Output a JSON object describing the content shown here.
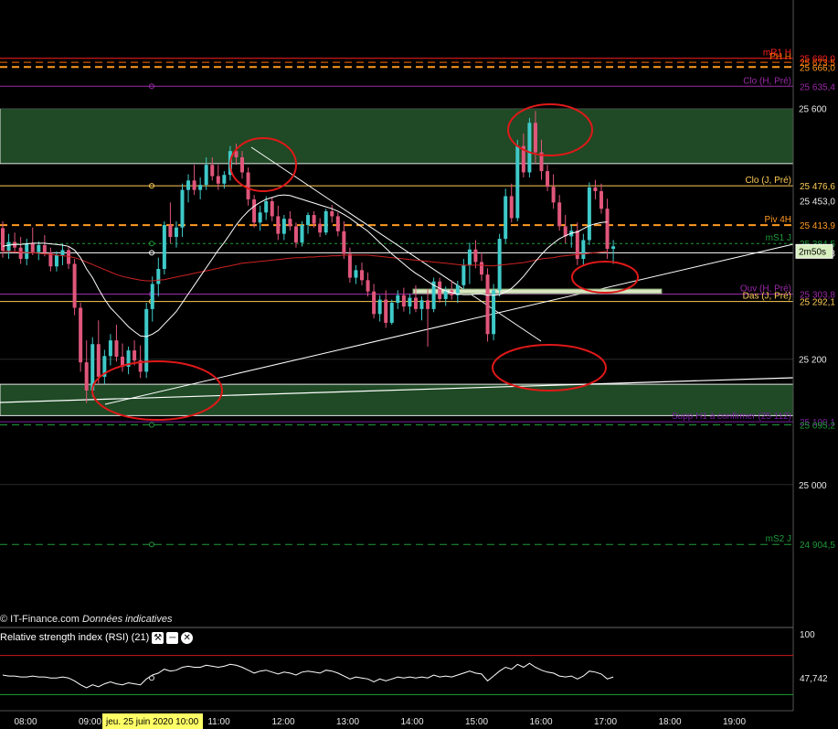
{
  "chart_data": [
    {
      "type": "candlestick",
      "timeframe": "2m",
      "ylim": [
        24810,
        25700
      ],
      "y_ticks": [
        "25 600",
        "25 200",
        "25 000"
      ],
      "y_tick_values": [
        25600,
        25200,
        25000
      ],
      "x_ticks": [
        "08:00",
        "09:00",
        "11:00",
        "12:00",
        "13:00",
        "14:00",
        "15:00",
        "16:00",
        "17:00",
        "18:00",
        "19:00"
      ],
      "x_tick_hours": [
        8,
        9,
        11,
        12,
        13,
        14,
        15,
        16,
        17,
        18,
        19
      ],
      "cursor_date_label": "jeu. 25 juin 2020 10:00",
      "candles": [
        [
          25409,
          25420,
          25362,
          25373
        ],
        [
          25373,
          25400,
          25360,
          25387
        ],
        [
          25387,
          25402,
          25370,
          25378
        ],
        [
          25378,
          25395,
          25352,
          25360
        ],
        [
          25360,
          25392,
          25350,
          25385
        ],
        [
          25385,
          25410,
          25366,
          25371
        ],
        [
          25371,
          25388,
          25358,
          25382
        ],
        [
          25382,
          25398,
          25364,
          25370
        ],
        [
          25370,
          25378,
          25340,
          25348
        ],
        [
          25348,
          25372,
          25340,
          25366
        ],
        [
          25366,
          25384,
          25350,
          25374
        ],
        [
          25374,
          25380,
          25344,
          25352
        ],
        [
          25352,
          25360,
          25270,
          25282
        ],
        [
          25282,
          25290,
          25180,
          25195
        ],
        [
          25195,
          25230,
          25130,
          25150
        ],
        [
          25150,
          25235,
          25140,
          25224
        ],
        [
          25224,
          25262,
          25160,
          25172
        ],
        [
          25172,
          25215,
          25160,
          25205
        ],
        [
          25205,
          25240,
          25190,
          25230
        ],
        [
          25230,
          25255,
          25196,
          25204
        ],
        [
          25204,
          25225,
          25180,
          25188
        ],
        [
          25188,
          25220,
          25176,
          25214
        ],
        [
          25214,
          25230,
          25190,
          25198
        ],
        [
          25198,
          25222,
          25170,
          25180
        ],
        [
          25180,
          25290,
          25170,
          25280
        ],
        [
          25280,
          25332,
          25260,
          25320
        ],
        [
          25320,
          25362,
          25300,
          25344
        ],
        [
          25344,
          25420,
          25335,
          25414
        ],
        [
          25414,
          25450,
          25385,
          25395
        ],
        [
          25395,
          25420,
          25378,
          25410
        ],
        [
          25410,
          25480,
          25395,
          25470
        ],
        [
          25470,
          25495,
          25450,
          25485
        ],
        [
          25485,
          25510,
          25462,
          25470
        ],
        [
          25470,
          25490,
          25455,
          25478
        ],
        [
          25478,
          25522,
          25470,
          25510
        ],
        [
          25510,
          25522,
          25485,
          25492
        ],
        [
          25492,
          25510,
          25470,
          25480
        ],
        [
          25480,
          25500,
          25472,
          25494
        ],
        [
          25494,
          25540,
          25485,
          25532
        ],
        [
          25532,
          25544,
          25510,
          25522
        ],
        [
          25522,
          25532,
          25488,
          25498
        ],
        [
          25498,
          25506,
          25445,
          25455
        ],
        [
          25455,
          25462,
          25410,
          25418
        ],
        [
          25418,
          25445,
          25405,
          25434
        ],
        [
          25434,
          25460,
          25422,
          25452
        ],
        [
          25452,
          25458,
          25420,
          25428
        ],
        [
          25428,
          25445,
          25390,
          25400
        ],
        [
          25400,
          25430,
          25390,
          25424
        ],
        [
          25424,
          25436,
          25405,
          25412
        ],
        [
          25412,
          25418,
          25378,
          25386
        ],
        [
          25386,
          25420,
          25380,
          25414
        ],
        [
          25414,
          25434,
          25400,
          25430
        ],
        [
          25430,
          25436,
          25410,
          25416
        ],
        [
          25416,
          25425,
          25395,
          25402
        ],
        [
          25402,
          25440,
          25398,
          25436
        ],
        [
          25436,
          25446,
          25418,
          25428
        ],
        [
          25428,
          25434,
          25396,
          25404
        ],
        [
          25404,
          25420,
          25360,
          25368
        ],
        [
          25368,
          25378,
          25322,
          25330
        ],
        [
          25330,
          25350,
          25320,
          25342
        ],
        [
          25342,
          25354,
          25318,
          25326
        ],
        [
          25326,
          25338,
          25300,
          25308
        ],
        [
          25308,
          25320,
          25265,
          25272
        ],
        [
          25272,
          25302,
          25260,
          25295
        ],
        [
          25295,
          25310,
          25250,
          25258
        ],
        [
          25258,
          25295,
          25255,
          25290
        ],
        [
          25290,
          25310,
          25280,
          25302
        ],
        [
          25302,
          25314,
          25276,
          25284
        ],
        [
          25284,
          25304,
          25272,
          25298
        ],
        [
          25298,
          25318,
          25275,
          25280
        ],
        [
          25280,
          25300,
          25262,
          25294
        ],
        [
          25294,
          25312,
          25220,
          25280
        ],
        [
          25280,
          25330,
          25275,
          25324
        ],
        [
          25324,
          25330,
          25290,
          25296
        ],
        [
          25296,
          25316,
          25285,
          25310
        ],
        [
          25310,
          25326,
          25295,
          25302
        ],
        [
          25302,
          25325,
          25290,
          25318
        ],
        [
          25318,
          25360,
          25312,
          25350
        ],
        [
          25350,
          25386,
          25320,
          25375
        ],
        [
          25375,
          25390,
          25345,
          25355
        ],
        [
          25355,
          25370,
          25325,
          25335
        ],
        [
          25335,
          25345,
          25228,
          25240
        ],
        [
          25240,
          25320,
          25230,
          25310
        ],
        [
          25310,
          25400,
          25300,
          25392
        ],
        [
          25392,
          25472,
          25385,
          25460
        ],
        [
          25460,
          25480,
          25418,
          25425
        ],
        [
          25425,
          25550,
          25420,
          25540
        ],
        [
          25540,
          25560,
          25490,
          25498
        ],
        [
          25498,
          25585,
          25490,
          25577
        ],
        [
          25577,
          25596,
          25512,
          25530
        ],
        [
          25530,
          25550,
          25486,
          25500
        ],
        [
          25500,
          25510,
          25468,
          25475
        ],
        [
          25475,
          25495,
          25440,
          25450
        ],
        [
          25450,
          25462,
          25405,
          25412
        ],
        [
          25412,
          25430,
          25385,
          25396
        ],
        [
          25396,
          25415,
          25378,
          25405
        ],
        [
          25405,
          25418,
          25350,
          25360
        ],
        [
          25360,
          25400,
          25350,
          25390
        ],
        [
          25390,
          25482,
          25382,
          25474
        ],
        [
          25474,
          25486,
          25455,
          25468
        ],
        [
          25468,
          25480,
          25432,
          25440
        ],
        [
          25440,
          25456,
          25360,
          25376
        ],
        [
          25376,
          25390,
          25352,
          25380
        ]
      ],
      "sma20": [
        25380,
        25382,
        25383,
        25383,
        25384,
        25385,
        25385,
        25385,
        25384,
        25383,
        25382,
        25380,
        25374,
        25362,
        25344,
        25330,
        25312,
        25296,
        25282,
        25272,
        25262,
        25252,
        25244,
        25237,
        25236,
        25240,
        25246,
        25256,
        25266,
        25276,
        25290,
        25304,
        25318,
        25332,
        25346,
        25360,
        25374,
        25386,
        25400,
        25414,
        25426,
        25436,
        25444,
        25450,
        25455,
        25458,
        25461,
        25462,
        25461,
        25458,
        25455,
        25452,
        25449,
        25446,
        25443,
        25440,
        25436,
        25431,
        25425,
        25418,
        25411,
        25404,
        25395,
        25386,
        25377,
        25368,
        25360,
        25352,
        25344,
        25337,
        25331,
        25324,
        25318,
        25313,
        25309,
        25306,
        25304,
        25303,
        25303,
        25304,
        25304,
        25302,
        25302,
        25303,
        25307,
        25313,
        25322,
        25332,
        25344,
        25356,
        25367,
        25377,
        25385,
        25392,
        25397,
        25401,
        25403,
        25408,
        25413,
        25416,
        25418,
        25419
      ],
      "sma100": [
        25372,
        25372,
        25371,
        25371,
        25370,
        25370,
        25369,
        25368,
        25367,
        25366,
        25365,
        25364,
        25362,
        25359,
        25355,
        25351,
        25347,
        25343,
        25339,
        25335,
        25332,
        25330,
        25328,
        25326,
        25325,
        25325,
        25326,
        25327,
        25329,
        25331,
        25333,
        25335,
        25337,
        25339,
        25341,
        25343,
        25345,
        25347,
        25349,
        25351,
        25353,
        25354,
        25355,
        25356,
        25357,
        25358,
        25359,
        25360,
        25361,
        25362,
        25362,
        25363,
        25363,
        25364,
        25364,
        25365,
        25365,
        25366,
        25366,
        25366,
        25366,
        25366,
        25365,
        25364,
        25363,
        25362,
        25361,
        25360,
        25359,
        25358,
        25357,
        25356,
        25355,
        25354,
        25353,
        25352,
        25351,
        25350,
        25350,
        25350,
        25350,
        25349,
        25349,
        25350,
        25351,
        25352,
        25353,
        25354,
        25356,
        25358,
        25360,
        25361,
        25362,
        25364,
        25365,
        25366,
        25367,
        25368,
        25369,
        25370,
        25371,
        25372
      ],
      "rsi": [
        50,
        49,
        49,
        48,
        48,
        49,
        48,
        48,
        47,
        47,
        48,
        47,
        44,
        40,
        37,
        40,
        38,
        41,
        43,
        41,
        40,
        42,
        41,
        40,
        46,
        50,
        52,
        56,
        54,
        55,
        58,
        59,
        58,
        58,
        60,
        59,
        58,
        59,
        61,
        60,
        58,
        55,
        52,
        54,
        55,
        53,
        51,
        53,
        52,
        50,
        53,
        54,
        53,
        52,
        55,
        54,
        52,
        49,
        46,
        48,
        47,
        46,
        43,
        46,
        44,
        46,
        48,
        47,
        48,
        47,
        48,
        47,
        50,
        48,
        49,
        48,
        50,
        52,
        54,
        52,
        51,
        44,
        49,
        54,
        58,
        56,
        61,
        58,
        62,
        58,
        55,
        53,
        52,
        49,
        48,
        49,
        46,
        49,
        54,
        53,
        51,
        46,
        48
      ],
      "horizontal_levels": [
        {
          "label": "mR1 H",
          "value_text": "25 680,0",
          "value": 25680,
          "color": "#ff2020",
          "style": "solid",
          "show_marker": false
        },
        {
          "label": "PH H",
          "value_text": "25 673,5",
          "value": 25673.5,
          "color": "#ff6a00",
          "style": "dashed",
          "show_marker": false
        },
        {
          "label": "",
          "value_text": "25 666,0",
          "value": 25666,
          "color": "#ff9a22",
          "style": "dashed",
          "show_marker": false
        },
        {
          "label": "Clo (H, Pré)",
          "value_text": "25 635,4",
          "value": 25635.4,
          "color": "#9b2aa8",
          "style": "solid",
          "show_marker": true
        },
        {
          "label": "Clo (J, Pré)",
          "value_text": "25 476,6",
          "value": 25476.6,
          "color": "#ffcc55",
          "style": "solid",
          "show_marker": true
        },
        {
          "label": "",
          "value_text": "25 453,0",
          "value": 25453,
          "color": "#ffffff",
          "style": "none",
          "show_marker": false
        },
        {
          "label": "Piv 4H",
          "value_text": "25 413,9",
          "value": 25413.9,
          "color": "#ff9a22",
          "style": "dashed",
          "show_marker": false
        },
        {
          "label": "mS1 J",
          "value_text": "25 384,5",
          "value": 25384.5,
          "color": "#1f9a3a",
          "style": "dotted",
          "show_marker": true
        },
        {
          "label": "",
          "value_text": "25 369,8",
          "value": 25369.8,
          "color": "#ffffff",
          "style": "solid",
          "show_marker": true
        },
        {
          "label": "Ouv (H, Pré)",
          "value_text": "25 303,8",
          "value": 25303.8,
          "color": "#9b2aa8",
          "style": "solid",
          "show_marker": true
        },
        {
          "label": "Das (J, Pré)",
          "value_text": "25 292,1",
          "value": 25292.1,
          "color": "#ffcc55",
          "style": "solid",
          "show_marker": true
        },
        {
          "label": "Supp H1 à confirmer (25 112)",
          "value_text": "25 100,1",
          "value": 25100.1,
          "color": "#7b1fa2",
          "style": "solid",
          "show_marker": false
        },
        {
          "label": "",
          "value_text": "25 095,2",
          "value": 25095.2,
          "color": "#1f9a3a",
          "style": "dashed",
          "show_marker": true
        },
        {
          "label": "mS2 J",
          "value_text": "24 904,5",
          "value": 24904.5,
          "color": "#1f9a3a",
          "style": "dashed",
          "show_marker": true
        }
      ],
      "zones": [
        {
          "from": 25512,
          "to": 25600
        },
        {
          "from": 25110,
          "to": 25160
        }
      ],
      "price_tag": "2m50s",
      "watermark": "© IT-Finance.com",
      "watermark_note": "Données indicatives",
      "rsi_title": "Relative strength index (RSI) (21)",
      "rsi_max_label": "100",
      "rsi_last_label": "47,742",
      "colors": {
        "bull": "#3fc9c9",
        "bear": "#e0567b",
        "zone": "#1f4a25",
        "sma20": "#ffffff",
        "sma100": "#cc2222"
      }
    }
  ]
}
